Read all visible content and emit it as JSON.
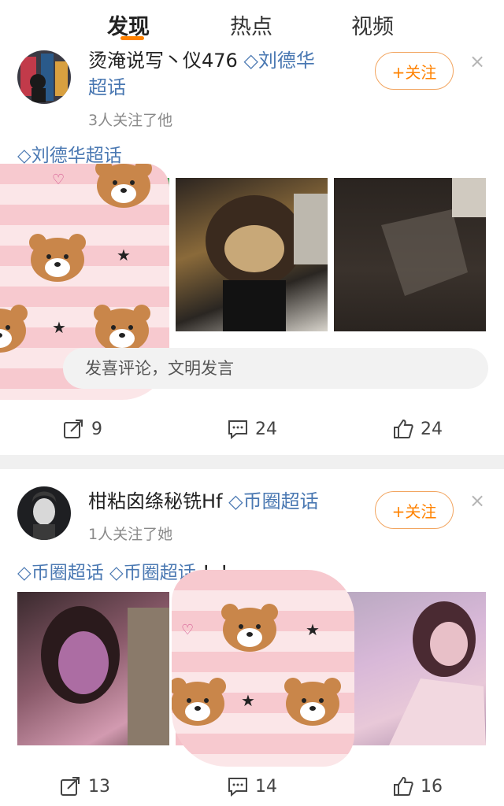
{
  "tabs": [
    {
      "label": "发现",
      "active": true
    },
    {
      "label": "热点",
      "active": false
    },
    {
      "label": "视频",
      "active": false
    }
  ],
  "posts": [
    {
      "username": "烫淹说写丶仪476",
      "topic_inline": "刘德华",
      "topic_inline_2": "超话",
      "follow_count": "3人关注了他",
      "follow_button": "+关注",
      "close": "×",
      "topic_line": "刘德华超话",
      "comment_placeholder": "发喜评论，文明发言",
      "repost_count": "9",
      "comment_count": "24",
      "like_count": "24"
    },
    {
      "username": "柑粘囟绦秘铣Hf",
      "topic_inline": "币圈超话",
      "follow_count": "1人关注了她",
      "follow_button": "+关注",
      "close": "×",
      "topic_line_a": "币圈超话",
      "topic_line_b": "币圈超话",
      "topic_line_suffix": "！！",
      "repost_count": "13",
      "comment_count": "14",
      "like_count": "16"
    }
  ],
  "colors": {
    "accent": "#ff8200",
    "link": "#4a78b2"
  },
  "icons": [
    "repost-icon",
    "comment-icon",
    "like-icon",
    "diamond-icon",
    "close-icon"
  ]
}
